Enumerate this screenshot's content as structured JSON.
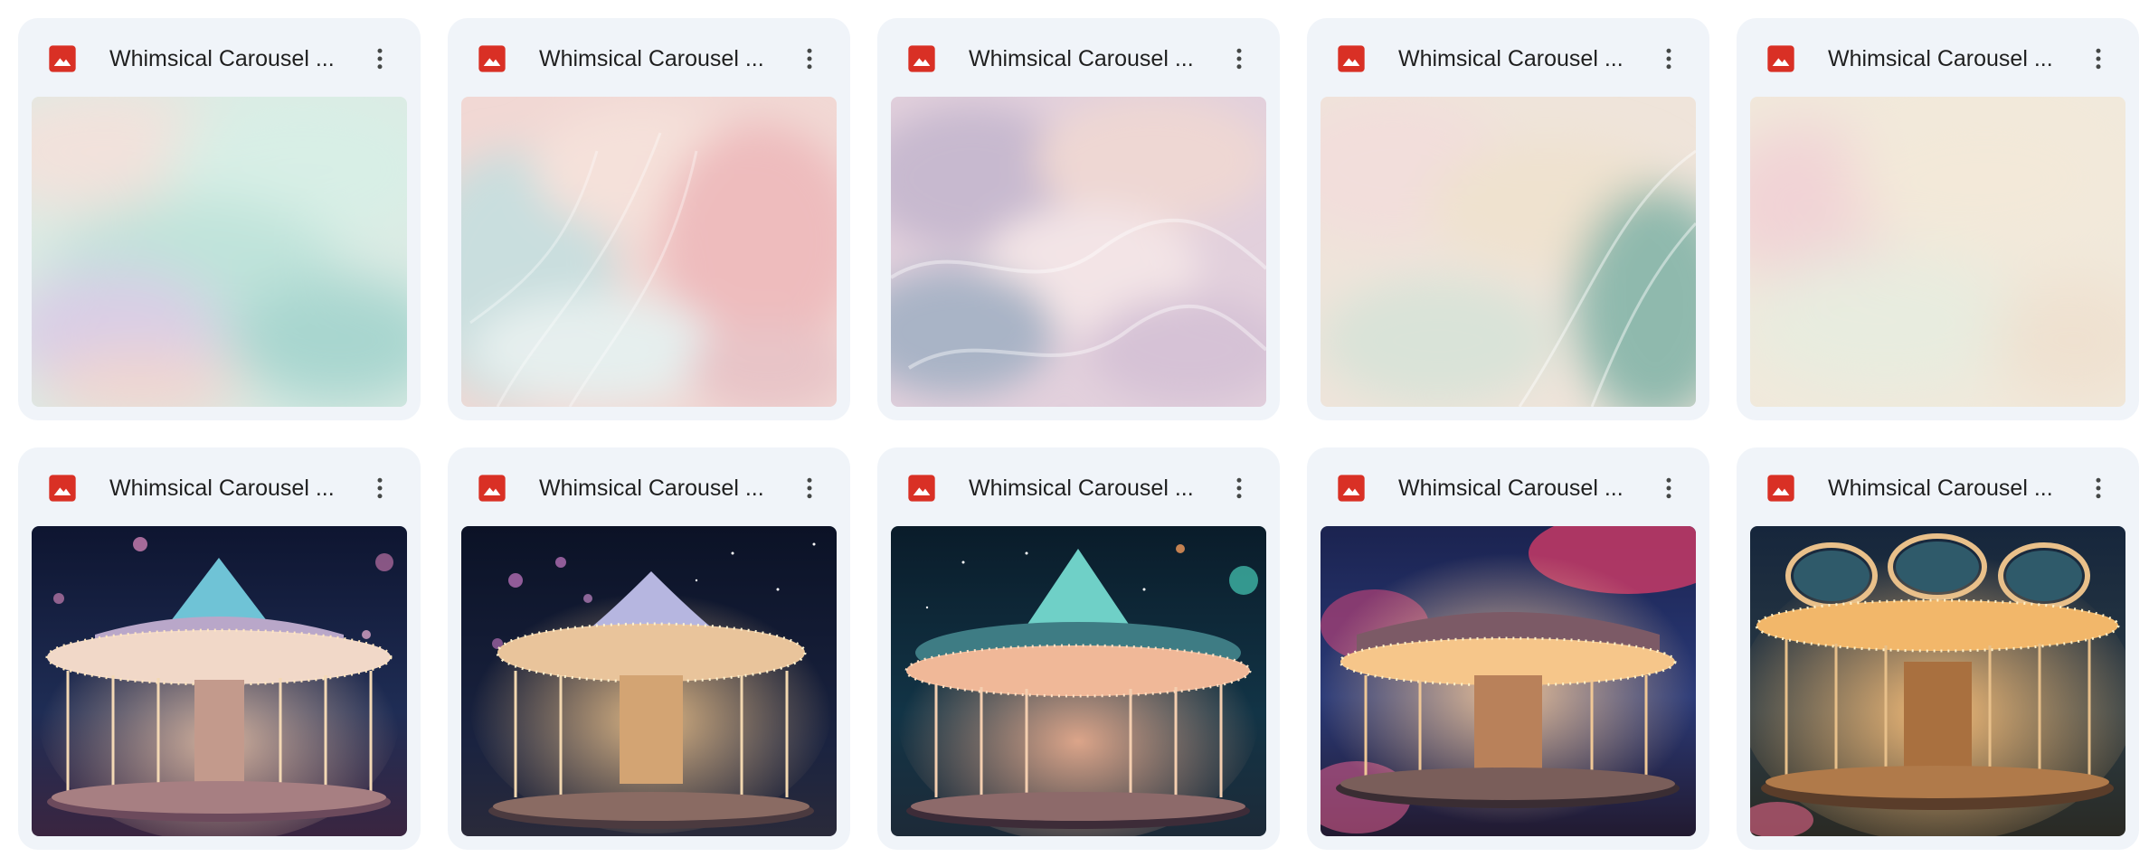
{
  "files": [
    {
      "name": "Whimsical Carousel ...",
      "icon": "image-file-icon",
      "thumbnail": "pastel-mint-cloud"
    },
    {
      "name": "Whimsical Carousel ...",
      "icon": "image-file-icon",
      "thumbnail": "pastel-pink-feathers"
    },
    {
      "name": "Whimsical Carousel ...",
      "icon": "image-file-icon",
      "thumbnail": "pastel-lilac-waves"
    },
    {
      "name": "Whimsical Carousel ...",
      "icon": "image-file-icon",
      "thumbnail": "pastel-sage-swirl"
    },
    {
      "name": "Whimsical Carousel ...",
      "icon": "image-file-icon",
      "thumbnail": "pastel-cream-haze"
    },
    {
      "name": "Whimsical Carousel ...",
      "icon": "image-file-icon",
      "thumbnail": "carousel-teal-canopy-night"
    },
    {
      "name": "Whimsical Carousel ...",
      "icon": "image-file-icon",
      "thumbnail": "carousel-lilac-canopy-night"
    },
    {
      "name": "Whimsical Carousel ...",
      "icon": "image-file-icon",
      "thumbnail": "carousel-teal-canopy-starry"
    },
    {
      "name": "Whimsical Carousel ...",
      "icon": "image-file-icon",
      "thumbnail": "carousel-pink-blossoms"
    },
    {
      "name": "Whimsical Carousel ...",
      "icon": "image-file-icon",
      "thumbnail": "carousel-golden-lights"
    }
  ],
  "colors": {
    "card_background": "#f0f4f9",
    "icon_red": "#d93025",
    "title_text": "#1f1f1f",
    "more_icon": "#444746"
  }
}
